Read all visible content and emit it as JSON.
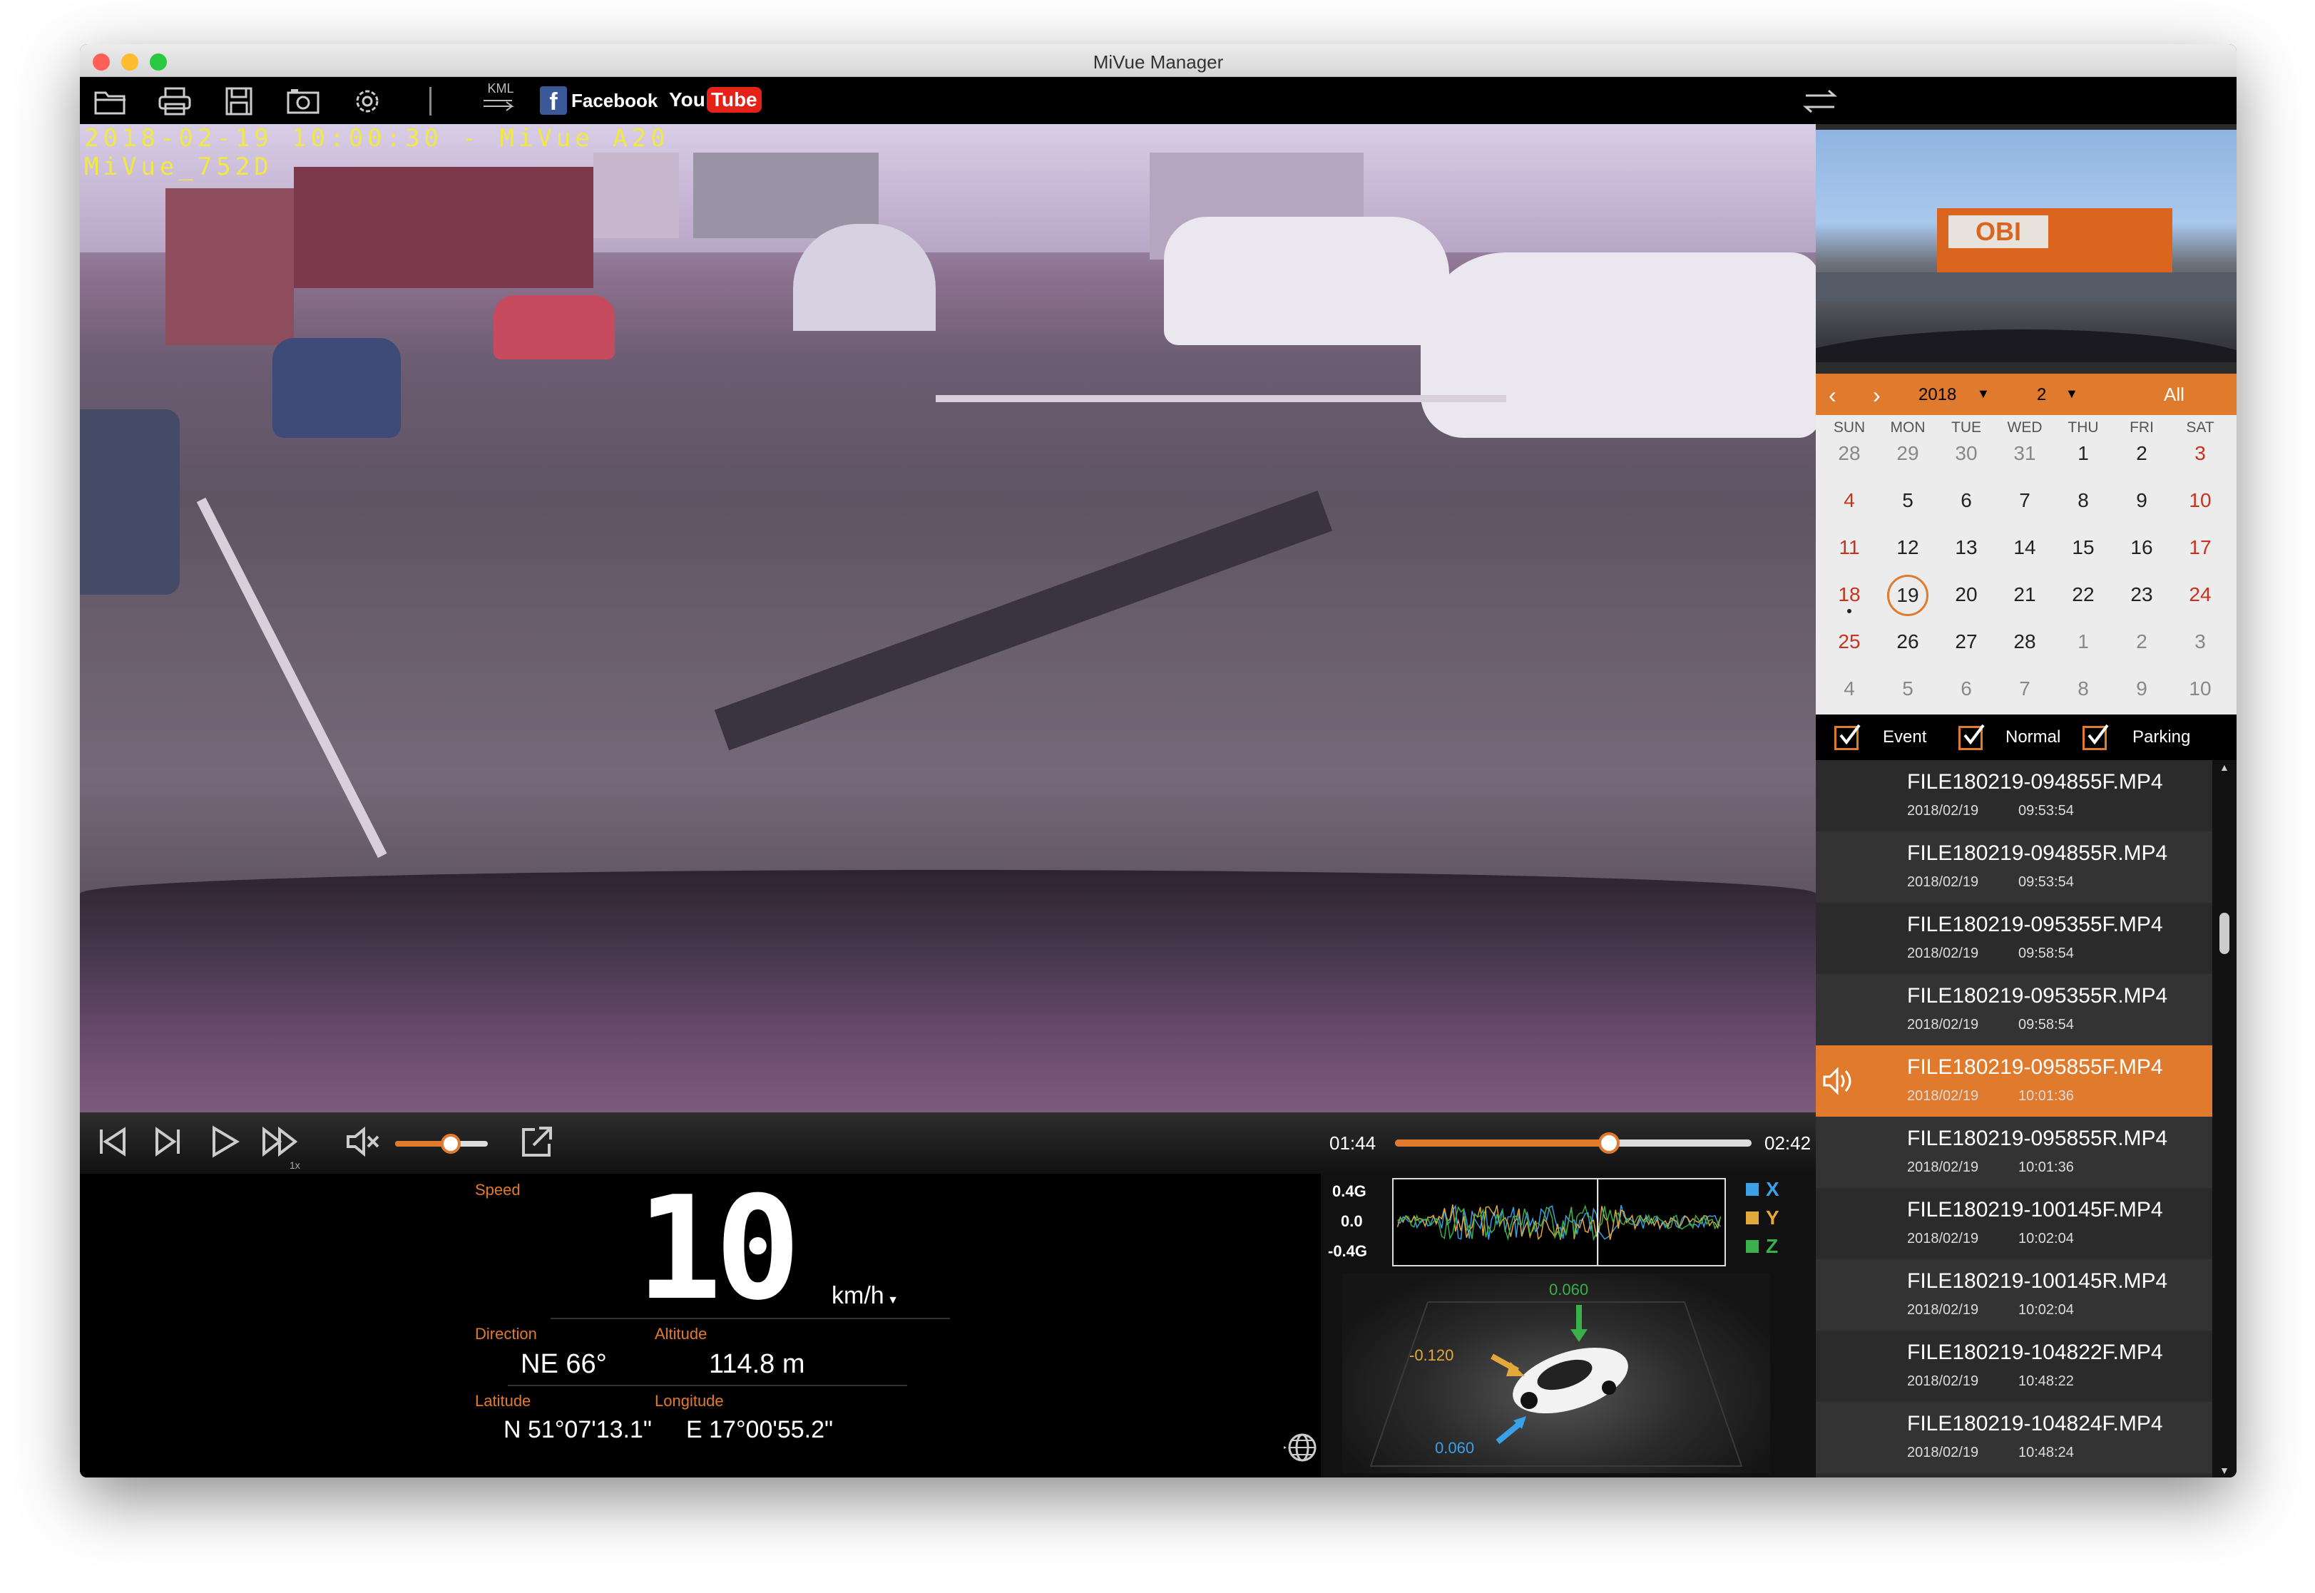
{
  "window": {
    "title": "MiVue Manager"
  },
  "toolbar": {
    "kml_label": "KML",
    "facebook_label": "Facebook",
    "youtube_you": "You",
    "youtube_tube": "Tube"
  },
  "video": {
    "overlay_line1": "2018-02-19  10:00:30 - MiVue A20",
    "overlay_line2": "MiVue_752D"
  },
  "player": {
    "speed_badge": "1x",
    "volume_level": 0.6,
    "current_time": "01:44",
    "total_time": "02:42",
    "progress_fraction": 0.6
  },
  "dashboard": {
    "speed_label": "Speed",
    "speed_value": "10",
    "speed_unit": "km/h",
    "direction_label": "Direction",
    "direction_value": "NE 66°",
    "altitude_label": "Altitude",
    "altitude_value": "114.8  m",
    "latitude_label": "Latitude",
    "latitude_value": "N 51°07'13.1\"",
    "longitude_label": "Longitude",
    "longitude_value": "E 17°00'55.2\""
  },
  "gsensor": {
    "scale_top": "0.4G",
    "scale_mid": "0.0",
    "scale_bottom": "-0.4G",
    "legend": [
      {
        "label": "X",
        "color": "#3aa0e8"
      },
      {
        "label": "Y",
        "color": "#e2a93a"
      },
      {
        "label": "Z",
        "color": "#3ab04a"
      }
    ],
    "value_top": "0.060",
    "value_left": "-0.120",
    "value_bottom": "0.060"
  },
  "calendar": {
    "year": "2018",
    "month": "2",
    "all_label": "All",
    "weekdays": [
      "SUN",
      "MON",
      "TUE",
      "WED",
      "THU",
      "FRI",
      "SAT"
    ],
    "weeks": [
      [
        "28",
        "29",
        "30",
        "31",
        "1",
        "2",
        "3"
      ],
      [
        "4",
        "5",
        "6",
        "7",
        "8",
        "9",
        "10"
      ],
      [
        "11",
        "12",
        "13",
        "14",
        "15",
        "16",
        "17"
      ],
      [
        "18",
        "19",
        "20",
        "21",
        "22",
        "23",
        "24"
      ],
      [
        "25",
        "26",
        "27",
        "28",
        "1",
        "2",
        "3"
      ],
      [
        "4",
        "5",
        "6",
        "7",
        "8",
        "9",
        "10"
      ]
    ],
    "selected_day": "19",
    "marked_day": "18"
  },
  "filters": {
    "event_label": "Event",
    "normal_label": "Normal",
    "parking_label": "Parking"
  },
  "files": [
    {
      "name": "FILE180219-094855F.MP4",
      "date": "2018/02/19",
      "time": "09:53:54"
    },
    {
      "name": "FILE180219-094855R.MP4",
      "date": "2018/02/19",
      "time": "09:53:54"
    },
    {
      "name": "FILE180219-095355F.MP4",
      "date": "2018/02/19",
      "time": "09:58:54"
    },
    {
      "name": "FILE180219-095355R.MP4",
      "date": "2018/02/19",
      "time": "09:58:54"
    },
    {
      "name": "FILE180219-095855F.MP4",
      "date": "2018/02/19",
      "time": "10:01:36"
    },
    {
      "name": "FILE180219-095855R.MP4",
      "date": "2018/02/19",
      "time": "10:01:36"
    },
    {
      "name": "FILE180219-100145F.MP4",
      "date": "2018/02/19",
      "time": "10:02:04"
    },
    {
      "name": "FILE180219-100145R.MP4",
      "date": "2018/02/19",
      "time": "10:02:04"
    },
    {
      "name": "FILE180219-104822F.MP4",
      "date": "2018/02/19",
      "time": "10:48:22"
    },
    {
      "name": "FILE180219-104824F.MP4",
      "date": "2018/02/19",
      "time": "10:48:24"
    }
  ],
  "selected_file_index": 4,
  "colors": {
    "accent": "#e07a2c",
    "weekend": "#c8321e"
  }
}
